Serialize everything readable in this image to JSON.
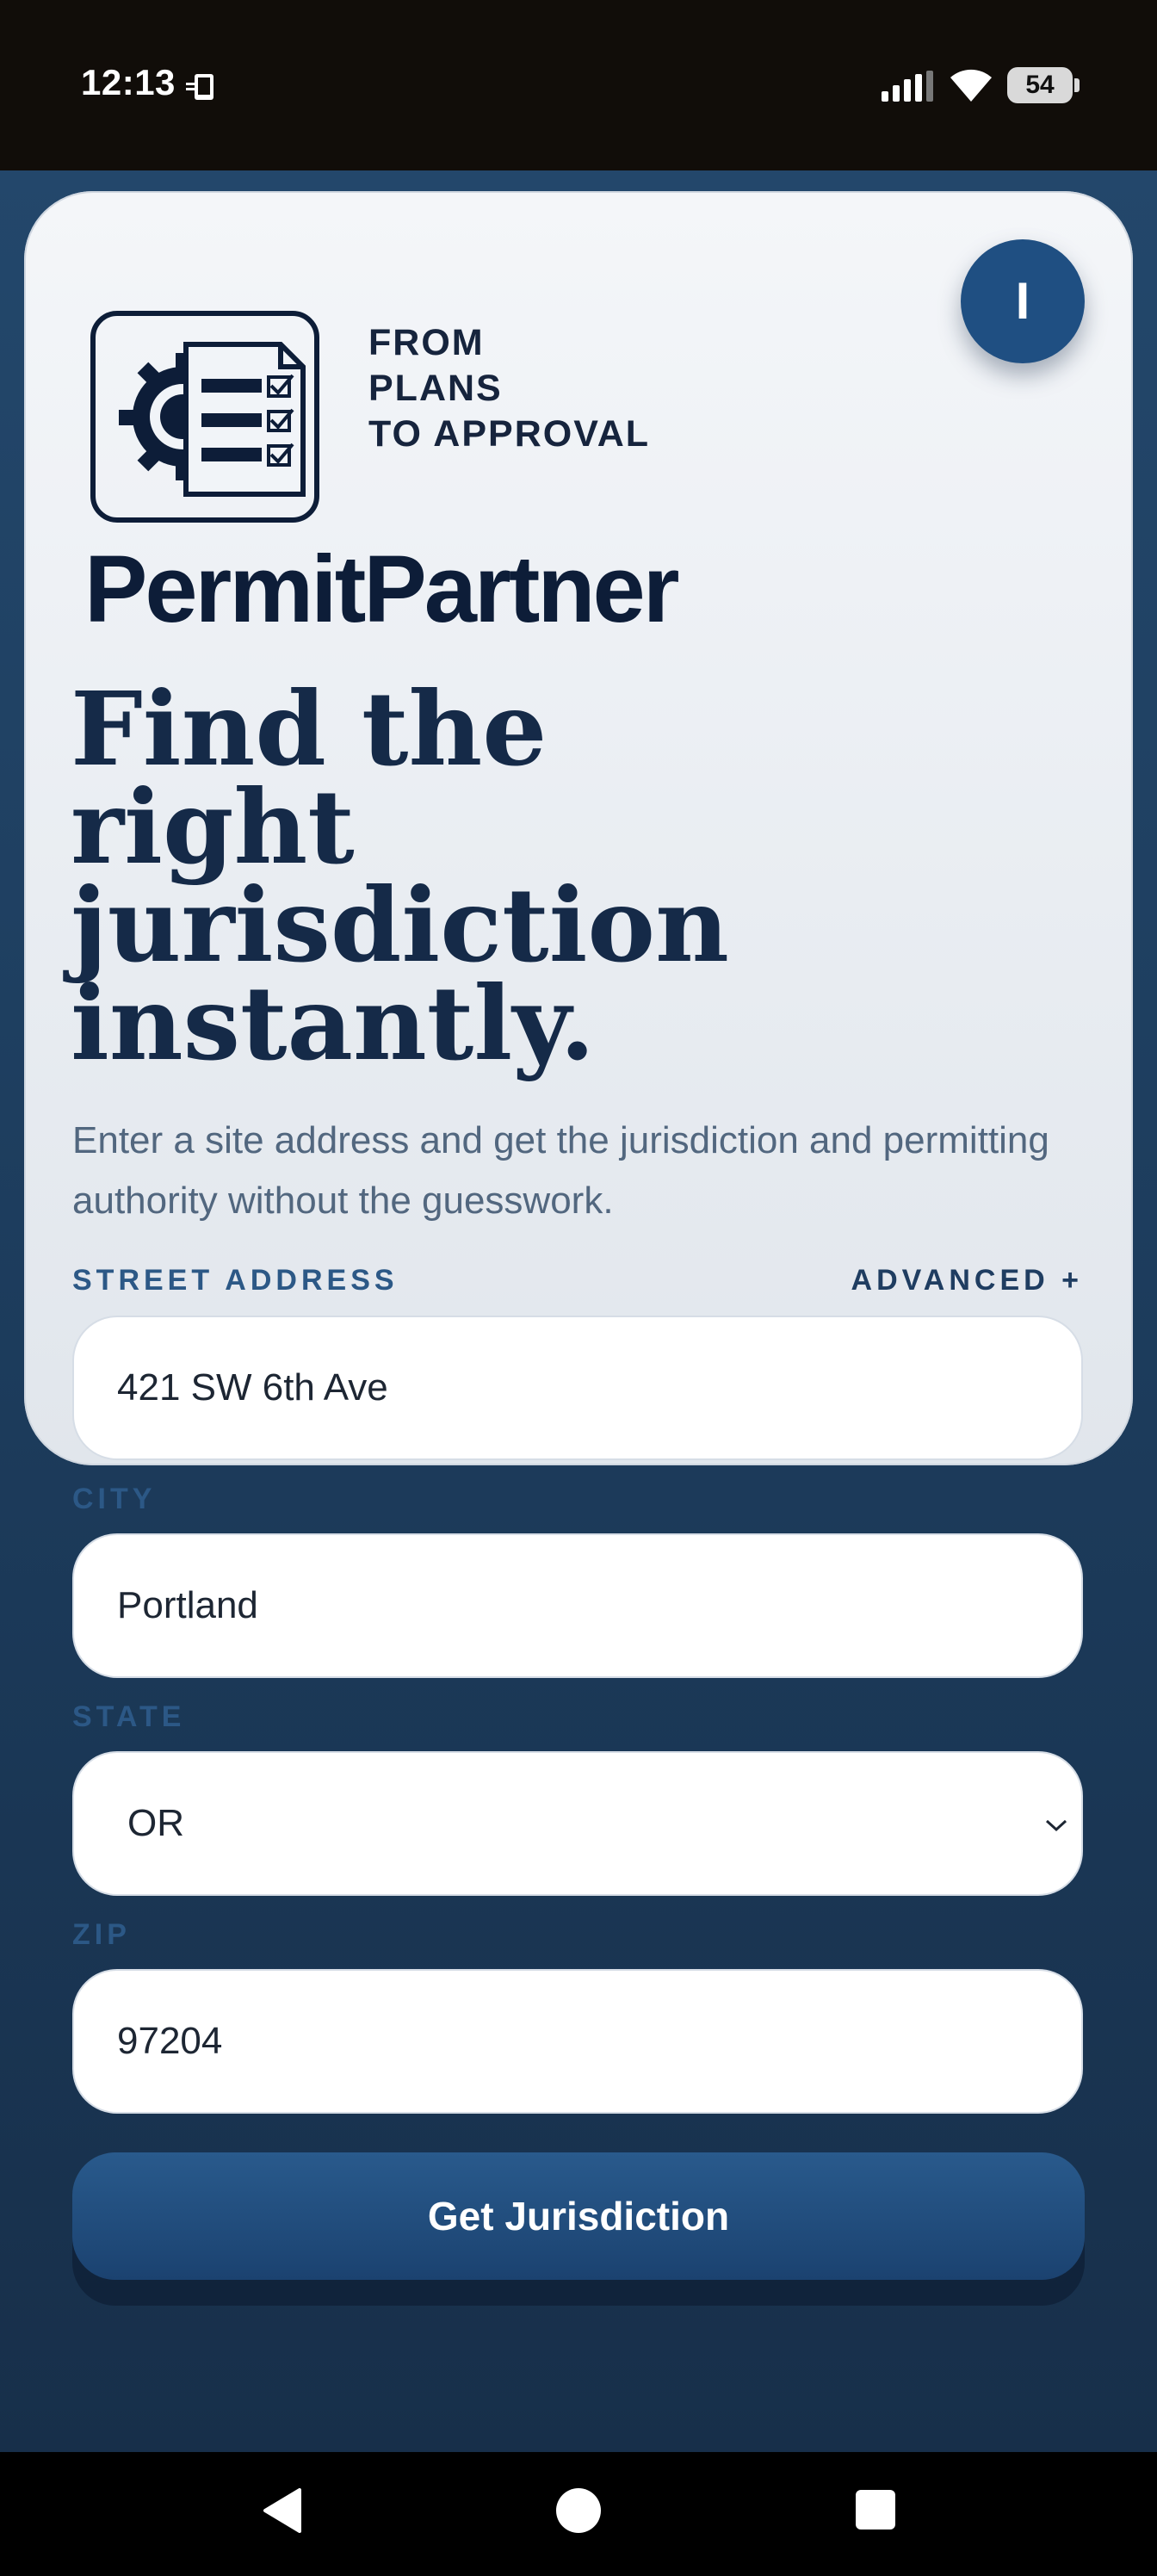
{
  "status_bar": {
    "time": "12:13",
    "battery": "54",
    "icons": [
      "phone-notification-icon",
      "signal-icon",
      "wifi-icon",
      "battery-icon"
    ]
  },
  "header": {
    "avatar_initial": "I",
    "tagline": [
      "FROM",
      "PLANS",
      "TO APPROVAL"
    ],
    "brand_name": "PermitPartner",
    "logo_icon": "permit-checklist-gear-icon"
  },
  "hero": {
    "headline_lines": [
      "Find the",
      "right",
      "jurisdiction",
      "instantly."
    ],
    "subtext": "Enter a site address and get the jurisdiction and permitting authority without the guesswork."
  },
  "form": {
    "street": {
      "label": "STREET ADDRESS",
      "value": "421 SW 6th Ave"
    },
    "advanced_label": "ADVANCED +",
    "city": {
      "label": "CITY",
      "value": "Portland"
    },
    "state": {
      "label": "STATE",
      "value": "OR"
    },
    "zip": {
      "label": "ZIP",
      "value": "97204"
    },
    "submit_label": "Get Jurisdiction"
  },
  "colors": {
    "accent": "#1f4f82",
    "heading": "#152a48",
    "label": "#2c5886",
    "background": "#1c3350"
  }
}
